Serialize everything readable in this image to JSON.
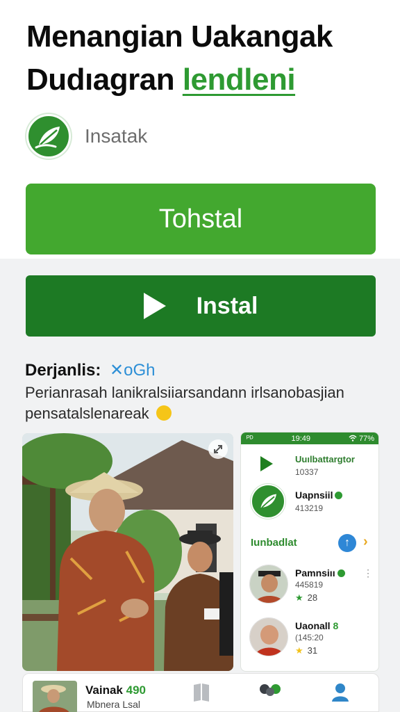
{
  "header": {
    "title_line1": "Menangian Uakangak",
    "title_line2": "Dudıagran",
    "title_highlight": "lendleni",
    "app_name": "Insatak"
  },
  "buttons": {
    "primary_label": "Tohstal",
    "install_label": "Instal"
  },
  "description": {
    "heading": "Derjanlis:",
    "tag": "✕oGh",
    "body": "Perianrasah lanikralsiiarsandann irlsanobasjian pensatalslenareak"
  },
  "phone_mock": {
    "status_left": "ᴾᴰ",
    "status_time": "19:49",
    "status_right": "77%",
    "row1_title": "Uuılbattargtor",
    "row1_sub": "10337",
    "row2_title": "Uapnsiil",
    "row2_sub": "413219",
    "section_title": "Iunbadlat",
    "user1_name": "Pamnsiıı",
    "user1_code": "445819",
    "user1_rating": "28",
    "user2_name": "Uaonall",
    "user2_num": "8",
    "user2_code": "(145:20",
    "user2_rating": "31"
  },
  "bottom_bar": {
    "title": "Vainak",
    "title_num": "490",
    "subtitle": "Mbnera Lsal"
  },
  "colors": {
    "brand_green": "#43a82f",
    "dark_green": "#1d7a24",
    "link_blue": "#2d8fd6"
  },
  "icons": [
    "leaf-logo-icon",
    "play-icon",
    "expand-icon",
    "signal-icon",
    "up-arrow-icon",
    "chevron-right-icon",
    "star-icon"
  ]
}
